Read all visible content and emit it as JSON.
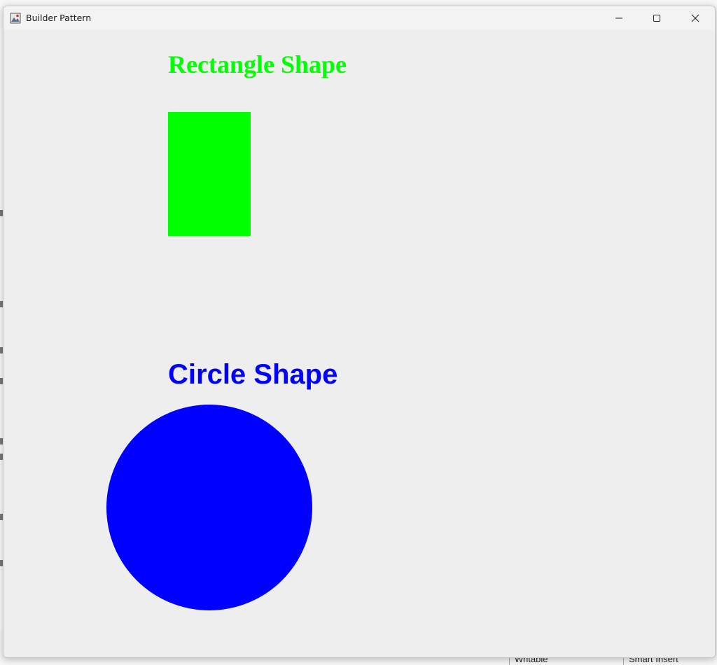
{
  "window": {
    "title": "Builder Pattern",
    "controls": {
      "minimize_icon": "minimize-icon",
      "maximize_icon": "maximize-icon",
      "close_icon": "close-icon"
    }
  },
  "shapes": {
    "rectangle": {
      "label": "Rectangle Shape",
      "color": "#00ff00"
    },
    "circle": {
      "label": "Circle Shape",
      "color": "#0000ff"
    }
  },
  "background_ide": {
    "status_writable": "Writable",
    "status_insert": "Smart Insert"
  }
}
